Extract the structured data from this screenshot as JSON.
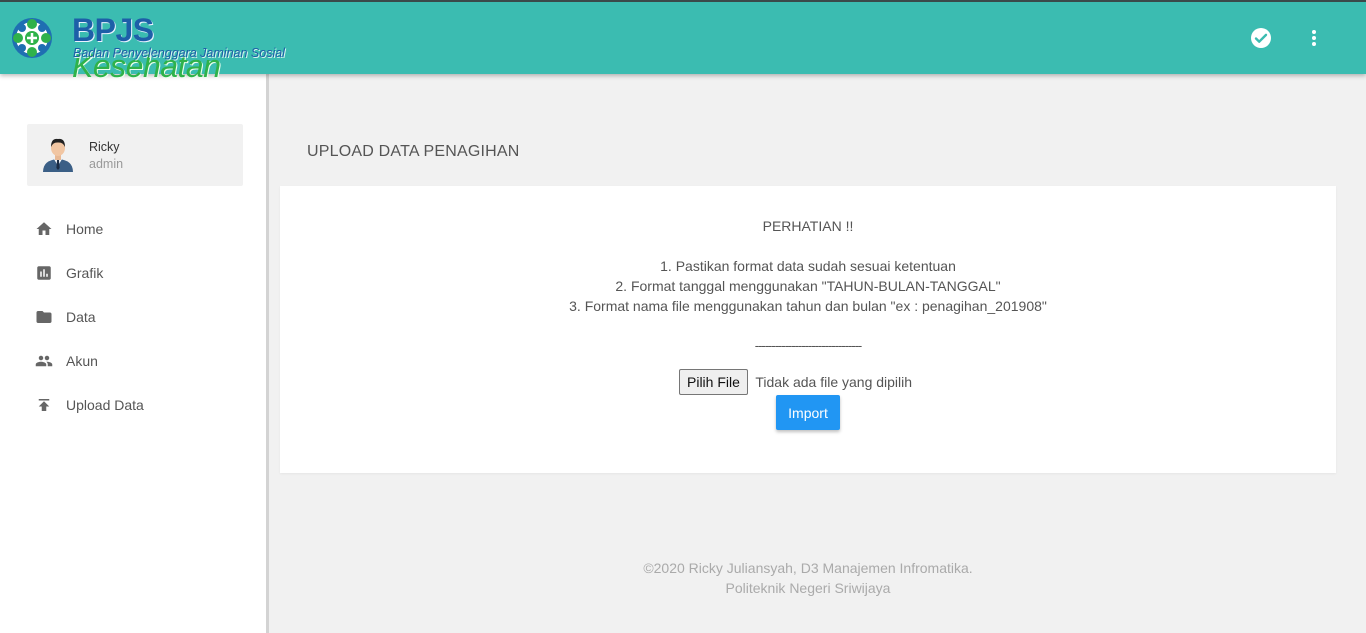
{
  "header": {
    "logo": {
      "name_part1": "BPJS",
      "name_part2": "Kesehatan",
      "tagline": "Badan Penyelenggara Jaminan Sosial"
    },
    "actions": [
      {
        "icon": "check-circle-icon"
      },
      {
        "icon": "more-vert-icon"
      }
    ],
    "colors": {
      "bar": "#3bbcb1",
      "brand_blue": "#1d5fa8",
      "brand_green": "#2fb24a"
    }
  },
  "user": {
    "name": "Ricky",
    "role": "admin"
  },
  "nav": [
    {
      "label": "Home",
      "icon": "home-icon"
    },
    {
      "label": "Grafik",
      "icon": "chart-icon"
    },
    {
      "label": "Data",
      "icon": "folder-icon"
    },
    {
      "label": "Akun",
      "icon": "people-icon"
    },
    {
      "label": "Upload Data",
      "icon": "upload-icon"
    }
  ],
  "page": {
    "title": "UPLOAD DATA PENAGIHAN"
  },
  "notice": {
    "title": "PERHATIAN !!",
    "rules": [
      "1. Pastikan format data sudah sesuai ketentuan",
      "2. Format tanggal menggunakan \"TAHUN-BULAN-TANGGAL\"",
      "3. Format nama file menggunakan tahun dan bulan \"ex : penagihan_201908\""
    ],
    "divider": "--------------------------------"
  },
  "upload": {
    "file_button": "Pilih File",
    "file_status": "Tidak ada file yang dipilih",
    "import_button": "Import",
    "import_color": "#2196f3"
  },
  "footer": {
    "line1": "©2020 Ricky Juliansyah, D3 Manajemen Infromatika.",
    "line2": "Politeknik Negeri Sriwijaya"
  }
}
